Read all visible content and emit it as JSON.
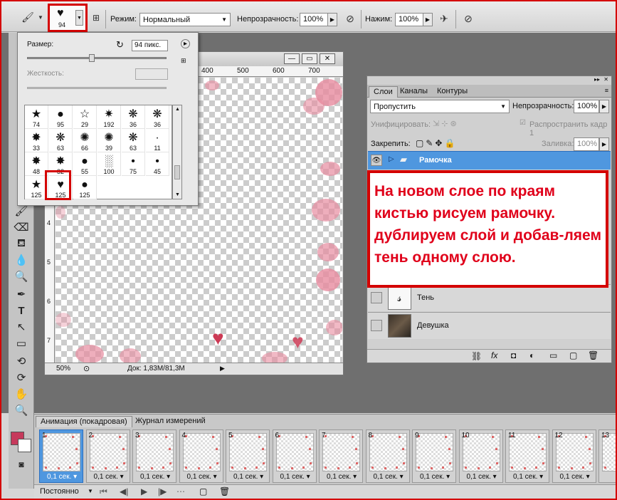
{
  "options_bar": {
    "brush_size": "94",
    "mode_label": "Режим:",
    "mode_value": "Нормальный",
    "opacity_label": "Непрозрачность:",
    "opacity_value": "100%",
    "flow_label": "Нажим:",
    "flow_value": "100%"
  },
  "brush_popup": {
    "size_label": "Размер:",
    "size_value": "94 пикс.",
    "hardness_label": "Жесткость:",
    "brushes": [
      {
        "glyph": "★",
        "size": "74"
      },
      {
        "glyph": "●",
        "size": "95"
      },
      {
        "glyph": "☆",
        "size": "29"
      },
      {
        "glyph": "✷",
        "size": "192"
      },
      {
        "glyph": "❋",
        "size": "36"
      },
      {
        "glyph": "❋",
        "size": "36"
      },
      {
        "glyph": "✸",
        "size": "33"
      },
      {
        "glyph": "❋",
        "size": "63"
      },
      {
        "glyph": "✺",
        "size": "66"
      },
      {
        "glyph": "✺",
        "size": "39"
      },
      {
        "glyph": "❋",
        "size": "63"
      },
      {
        "glyph": "·",
        "size": "11"
      },
      {
        "glyph": "✸",
        "size": "48"
      },
      {
        "glyph": "✸",
        "size": "32"
      },
      {
        "glyph": "●",
        "size": "55"
      },
      {
        "glyph": "░",
        "size": "100"
      },
      {
        "glyph": "•",
        "size": "75"
      },
      {
        "glyph": "•",
        "size": "45"
      },
      {
        "glyph": "★",
        "size": "125"
      },
      {
        "glyph": "♥",
        "size": "125"
      },
      {
        "glyph": "●",
        "size": "125"
      }
    ]
  },
  "document": {
    "ruler_labels": [
      "400",
      "500",
      "600",
      "700"
    ],
    "ruler_v_labels": [
      "4",
      "5",
      "6",
      "7"
    ],
    "zoom": "50%",
    "doc_info": "Док: 1,83M/81,3M"
  },
  "layers_panel": {
    "tabs": [
      "Слои",
      "Каналы",
      "Контуры"
    ],
    "blend_mode": "Пропустить",
    "opacity_label": "Непрозрачность:",
    "opacity_value": "100%",
    "unify_label": "Унифицировать:",
    "propagate_label": "Распространить кадр 1",
    "lock_label": "Закрепить:",
    "fill_label": "Заливка:",
    "fill_value": "100%",
    "layers": [
      {
        "name": "Рамочка"
      },
      {
        "name": "Тень"
      },
      {
        "name": "Девушка"
      }
    ]
  },
  "annotation": "На новом слое по краям кистью рисуем рамочку. дублируем слой и добав-ляем тень одному слою.",
  "animation_panel": {
    "tabs": [
      "Анимация (покадровая)",
      "Журнал измерений"
    ],
    "frames": [
      {
        "num": "1",
        "delay": "0,1 сек."
      },
      {
        "num": "2",
        "delay": "0,1 сек."
      },
      {
        "num": "3",
        "delay": "0,1 сек."
      },
      {
        "num": "4",
        "delay": "0,1 сек."
      },
      {
        "num": "5",
        "delay": "0,1 сек."
      },
      {
        "num": "6",
        "delay": "0,1 сек."
      },
      {
        "num": "7",
        "delay": "0,1 сек."
      },
      {
        "num": "8",
        "delay": "0,1 сек."
      },
      {
        "num": "9",
        "delay": "0,1 сек."
      },
      {
        "num": "10",
        "delay": "0,1 сек."
      },
      {
        "num": "11",
        "delay": "0,1 сек."
      },
      {
        "num": "12",
        "delay": "0,1 сек."
      },
      {
        "num": "13",
        "delay": ""
      }
    ],
    "loop_value": "Постоянно"
  },
  "colors": {
    "foreground": "#c63a5c",
    "annotation_red": "#e0001a",
    "highlight": "#d40000",
    "selected_layer": "#4f97df"
  }
}
